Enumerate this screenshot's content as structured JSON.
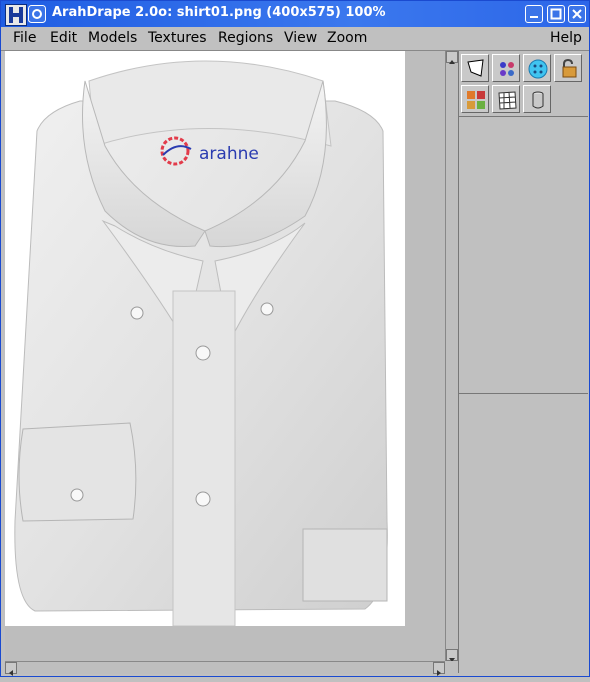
{
  "window": {
    "title": "ArahDrape 2.0o: shirt01.png (400x575) 100%",
    "title_bar_color": "#2c66e8"
  },
  "menu": {
    "items": [
      "File",
      "Edit",
      "Models",
      "Textures",
      "Regions",
      "View",
      "Zoom"
    ],
    "help": "Help"
  },
  "image": {
    "logo_text": "arahne"
  },
  "toolbar": {
    "tools": [
      "select-region-icon",
      "color-dots-icon",
      "button-icon",
      "padlock-icon",
      "masks-icon",
      "grid-mesh-icon",
      "cylinder-icon"
    ]
  }
}
